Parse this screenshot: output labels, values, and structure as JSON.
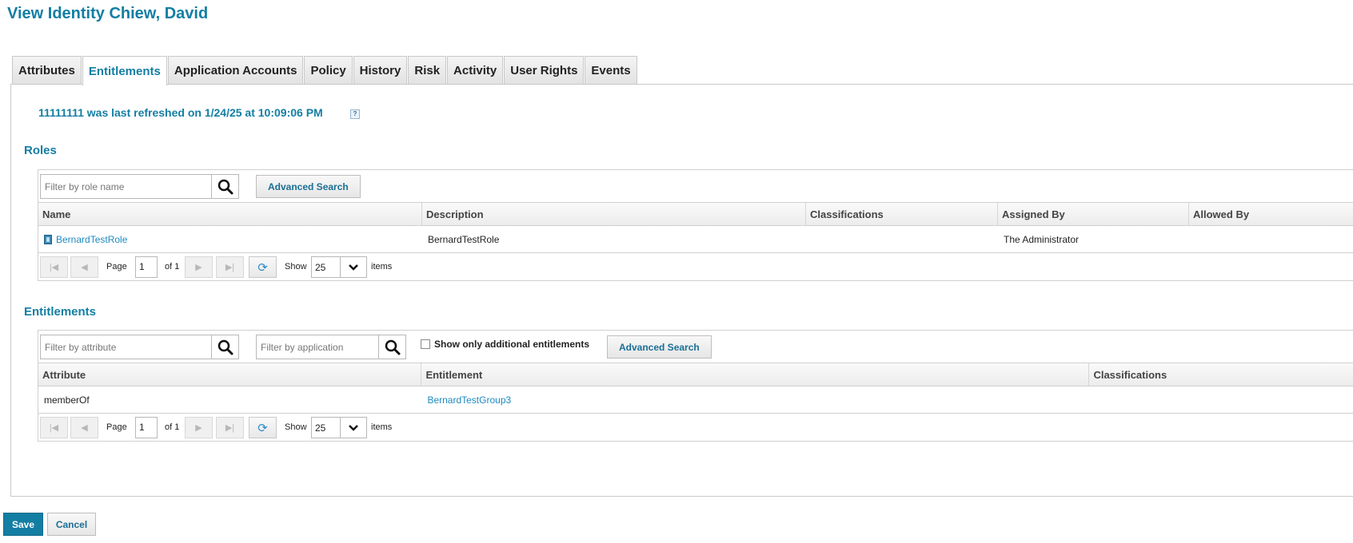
{
  "page": {
    "title": "View Identity Chiew, David"
  },
  "tabs": [
    {
      "label": "Attributes"
    },
    {
      "label": "Entitlements"
    },
    {
      "label": "Application Accounts"
    },
    {
      "label": "Policy"
    },
    {
      "label": "History"
    },
    {
      "label": "Risk"
    },
    {
      "label": "Activity"
    },
    {
      "label": "User Rights"
    },
    {
      "label": "Events"
    }
  ],
  "active_tab": "Entitlements",
  "refresh_message": "11111111 was last refreshed on 1/24/25 at 10:09:06 PM",
  "help_icon_glyph": "?",
  "roles": {
    "title": "Roles",
    "filter_placeholder": "Filter by role name",
    "advanced_search": "Advanced Search",
    "columns": [
      "Name",
      "Description",
      "Classifications",
      "Assigned By",
      "Allowed By"
    ],
    "rows": [
      {
        "name": "BernardTestRole",
        "description": "BernardTestRole",
        "classifications": "",
        "assigned_by": "The Administrator",
        "allowed_by": ""
      }
    ],
    "pager": {
      "page_label": "Page",
      "page": "1",
      "of_label": "of 1",
      "show_label": "Show",
      "page_size": "25",
      "items_label": "items"
    }
  },
  "entitlements": {
    "title": "Entitlements",
    "filter_attribute_placeholder": "Filter by attribute",
    "filter_application_placeholder": "Filter by application",
    "checkbox_label": "Show only additional entitlements",
    "checkbox_checked": false,
    "advanced_search": "Advanced Search",
    "columns": [
      "Attribute",
      "Entitlement",
      "Classifications"
    ],
    "rows": [
      {
        "attribute": "memberOf",
        "entitlement": "BernardTestGroup3",
        "classifications": ""
      }
    ],
    "pager": {
      "page_label": "Page",
      "page": "1",
      "of_label": "of 1",
      "show_label": "Show",
      "page_size": "25",
      "items_label": "items"
    }
  },
  "footer": {
    "save_label": "Save",
    "cancel_label": "Cancel"
  },
  "colors": {
    "accent": "#137ea3",
    "link": "#1d8ac0",
    "border": "#c8c8c8"
  }
}
